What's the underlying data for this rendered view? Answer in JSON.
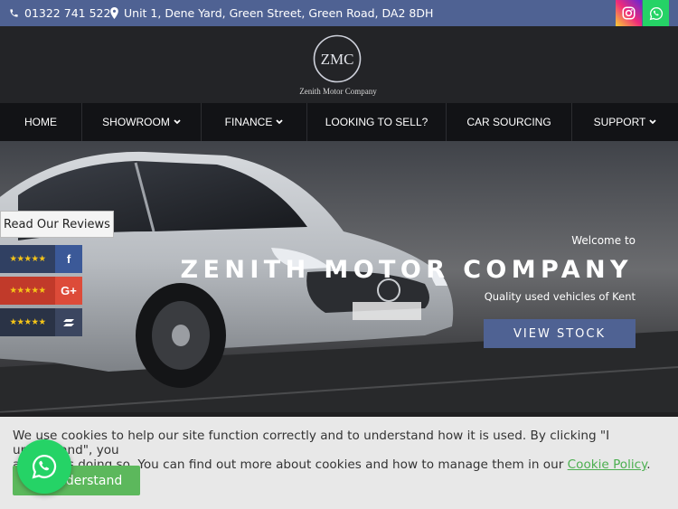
{
  "topbar": {
    "phone": "01322 741 522",
    "address": "Unit 1, Dene Yard, Green Street, Green Road, DA2 8DH",
    "icons": [
      "phone-icon",
      "map-marker-icon",
      "instagram-icon",
      "whatsapp-icon"
    ]
  },
  "logo": {
    "monogram": "ZMC",
    "name": "Zenith Motor Company"
  },
  "nav": {
    "items": [
      {
        "label": "HOME"
      },
      {
        "label": "SHOWROOM"
      },
      {
        "label": "FINANCE"
      },
      {
        "label": "LOOKING TO SELL?"
      },
      {
        "label": "CAR SOURCING"
      },
      {
        "label": "SUPPORT"
      }
    ]
  },
  "hero": {
    "welcome": "Welcome to",
    "title": "ZENITH MOTOR COMPANY",
    "subtitle": "Quality used vehicles of Kent",
    "cta": "VIEW STOCK"
  },
  "reviews": {
    "tab_label": "Read Our Reviews",
    "items": [
      {
        "stars": "★★★★★",
        "icon": "f"
      },
      {
        "stars": "★★★★★",
        "icon": "G+"
      },
      {
        "stars": "★★★★★",
        "icon": ""
      }
    ]
  },
  "cookie": {
    "line1": "We use cookies to help our site function correctly and to understand how it is used. By clicking \"I understand\", you",
    "line2_prefix": "are",
    "line2_mid": "us doing so. You can find out more about cookies and how to manage them in our ",
    "link": "Cookie Policy",
    "line2_suffix": ".",
    "button": "Understand"
  },
  "colors": {
    "brand": "#4f6293",
    "whatsapp": "#25d366",
    "cookie_button": "#5cb85c"
  }
}
